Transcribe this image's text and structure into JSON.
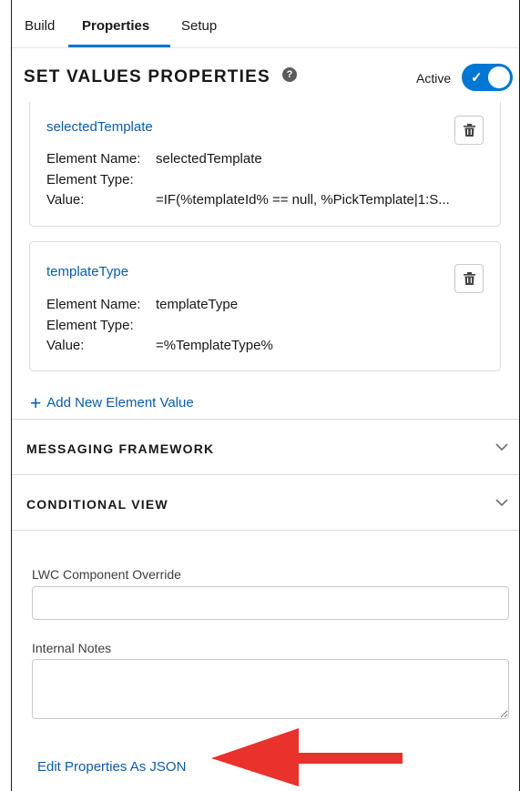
{
  "tabs": [
    {
      "label": "Build"
    },
    {
      "label": "Properties"
    },
    {
      "label": "Setup"
    }
  ],
  "header": {
    "title": "SET VALUES PROPERTIES",
    "active_label": "Active",
    "active": true
  },
  "elements": [
    {
      "title": "selectedTemplate",
      "name_label": "Element Name:",
      "name_value": "selectedTemplate",
      "type_label": "Element Type:",
      "type_value": "",
      "value_label": "Value:",
      "value_value": "=IF(%templateId% == null, %PickTemplate|1:S..."
    },
    {
      "title": "templateType",
      "name_label": "Element Name:",
      "name_value": "templateType",
      "type_label": "Element Type:",
      "type_value": "",
      "value_label": "Value:",
      "value_value": "=%TemplateType%"
    }
  ],
  "add_element_label": "Add New Element Value",
  "sections": [
    {
      "title": "MESSAGING FRAMEWORK"
    },
    {
      "title": "CONDITIONAL VIEW"
    }
  ],
  "form": {
    "lwc_label": "LWC Component Override",
    "lwc_value": "",
    "notes_label": "Internal Notes",
    "notes_value": ""
  },
  "edit_json_label": "Edit Properties As JSON",
  "colors": {
    "accent": "#0176d3",
    "link": "#0b5cab",
    "annotation_arrow": "#e8322b"
  },
  "icons": [
    "help-icon",
    "check-icon",
    "trash-icon",
    "plus-icon",
    "chevron-down-icon"
  ]
}
